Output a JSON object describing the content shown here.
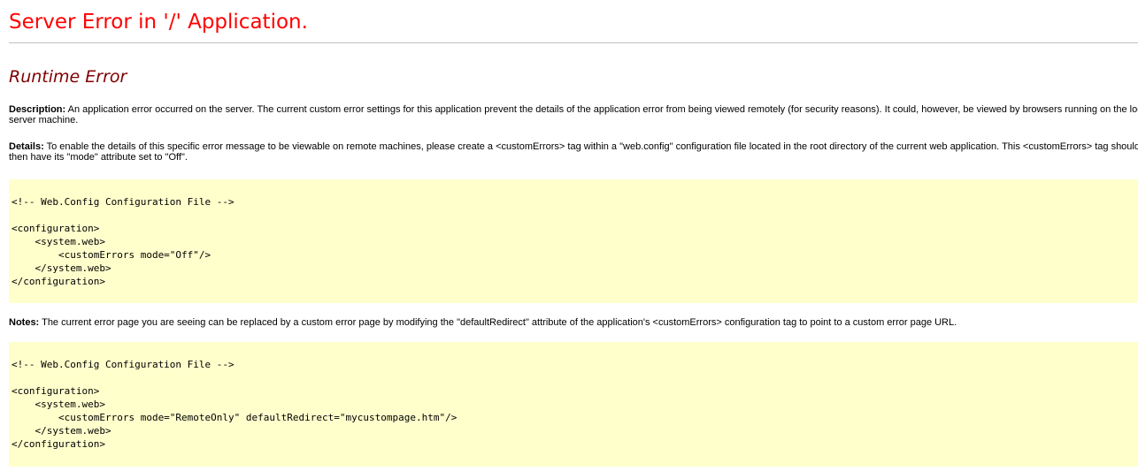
{
  "page": {
    "title": "Server Error in '/' Application.",
    "subtitle": "Runtime Error"
  },
  "description": {
    "label": "Description:",
    "text": "An application error occurred on the server. The current custom error settings for this application prevent the details of the application error from being viewed remotely (for security reasons). It could, however, be viewed by browsers running on the local server machine."
  },
  "details": {
    "label": "Details:",
    "text": "To enable the details of this specific error message to be viewable on remote machines, please create a <customErrors> tag within a \"web.config\" configuration file located in the root directory of the current web application. This <customErrors> tag should then have its \"mode\" attribute set to \"Off\"."
  },
  "code_block_1": "<!-- Web.Config Configuration File -->\n\n<configuration>\n    <system.web>\n        <customErrors mode=\"Off\"/>\n    </system.web>\n</configuration>",
  "notes": {
    "label": "Notes:",
    "text": "The current error page you are seeing can be replaced by a custom error page by modifying the \"defaultRedirect\" attribute of the application's <customErrors> configuration tag to point to a custom error page URL."
  },
  "code_block_2": "<!-- Web.Config Configuration File -->\n\n<configuration>\n    <system.web>\n        <customErrors mode=\"RemoteOnly\" defaultRedirect=\"mycustompage.htm\"/>\n    </system.web>\n</configuration>",
  "colors": {
    "title": "#ff0000",
    "subtitle": "#800000",
    "code_background": "#ffffcc"
  }
}
